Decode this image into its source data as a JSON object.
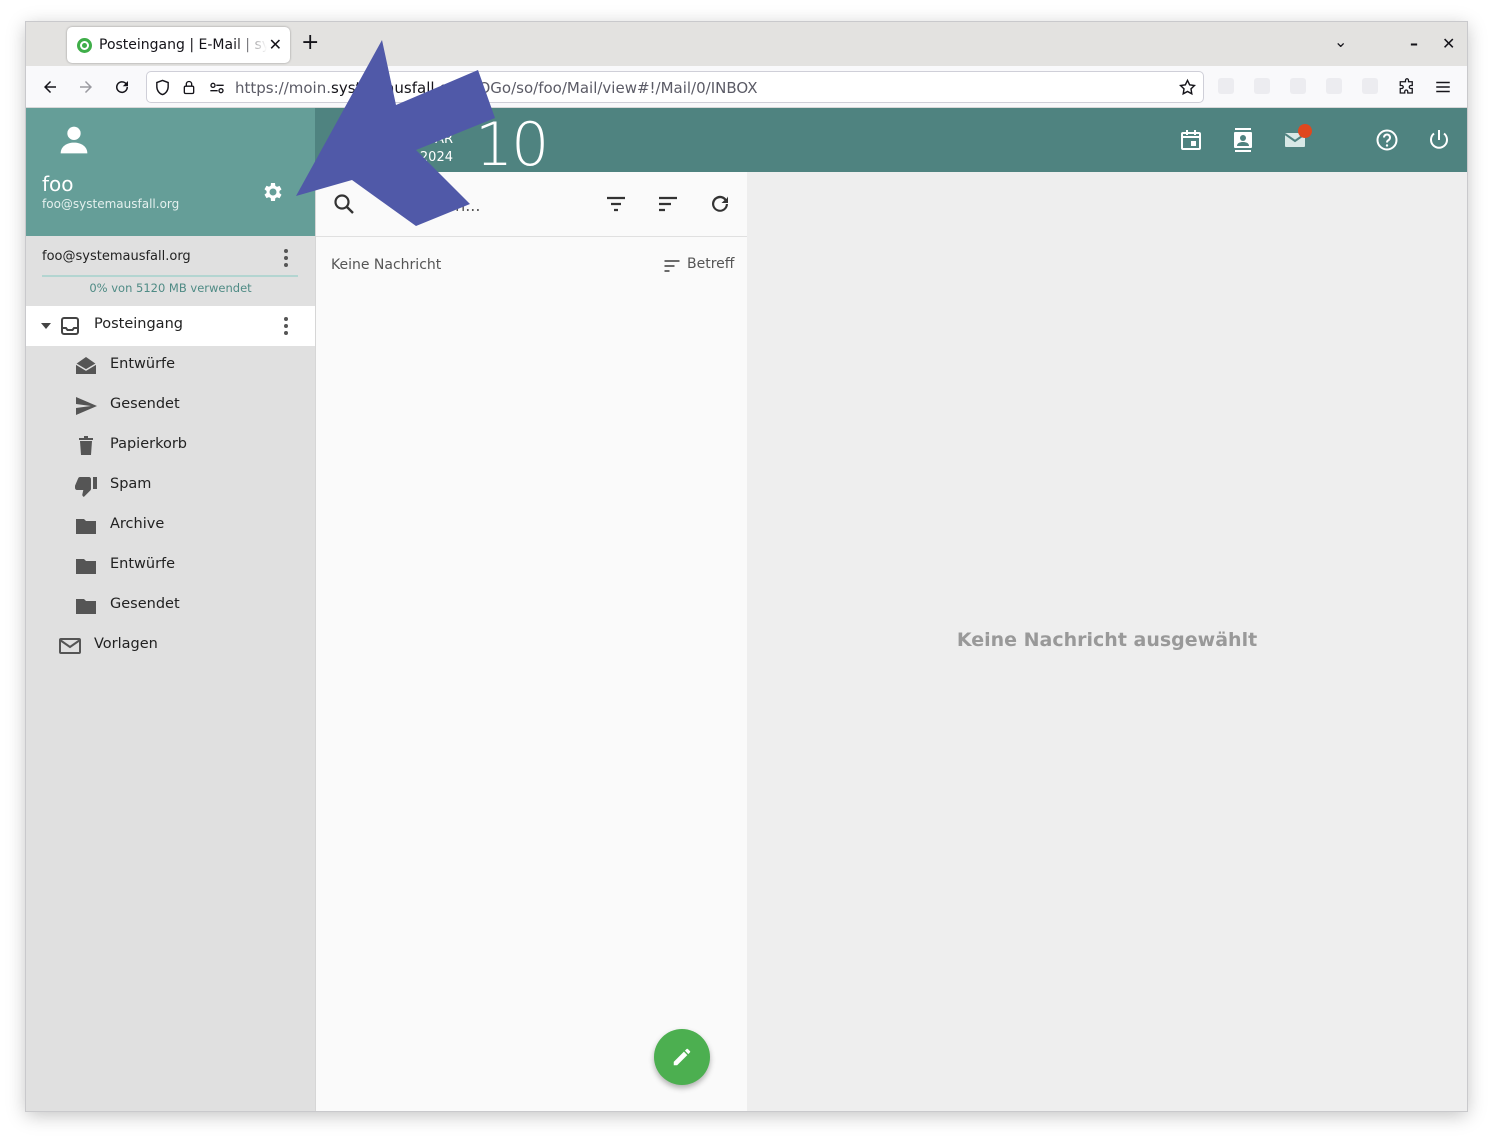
{
  "browser": {
    "tab_title": "Posteingang | E-Mail | systemausfall",
    "new_tab_symbol": "+",
    "url_host_pre": "https://moin.",
    "url_host_bold": "systemausfall.org",
    "url_path": "/SOGo/so/foo/Mail/view#!/Mail/0/INBOX",
    "close_symbol": "✕",
    "minimize_symbol": "–",
    "chevron_symbol": "⌄"
  },
  "user": {
    "name": "foo",
    "email": "foo@systemausfall.org"
  },
  "account": {
    "email": "foo@systemausfall.org",
    "quota_text": "0% von 5120 MB verwendet",
    "quota_percent": 0
  },
  "folders": [
    {
      "label": "Posteingang",
      "icon": "inbox-icon"
    },
    {
      "label": "Entwürfe",
      "icon": "drafts-icon"
    },
    {
      "label": "Gesendet",
      "icon": "send-icon"
    },
    {
      "label": "Papierkorb",
      "icon": "trash-icon"
    },
    {
      "label": "Spam",
      "icon": "thumb-down-icon"
    },
    {
      "label": "Archive",
      "icon": "folder-icon"
    },
    {
      "label": "Entwürfe",
      "icon": "folder-icon"
    },
    {
      "label": "Gesendet",
      "icon": "folder-icon"
    },
    {
      "label": "Vorlagen",
      "icon": "mail-icon"
    }
  ],
  "date": {
    "month": "JANUAR",
    "year": "2024",
    "day": "10"
  },
  "list": {
    "search_label": "Suchen...",
    "empty_text": "Keine Nachricht",
    "sort_label": "Betreff"
  },
  "reader": {
    "empty_text": "Keine Nachricht ausgewählt"
  },
  "colors": {
    "header": "#4f8380",
    "user_panel": "#659e98",
    "fab": "#4caf50",
    "annotation_arrow": "#5059a8"
  }
}
